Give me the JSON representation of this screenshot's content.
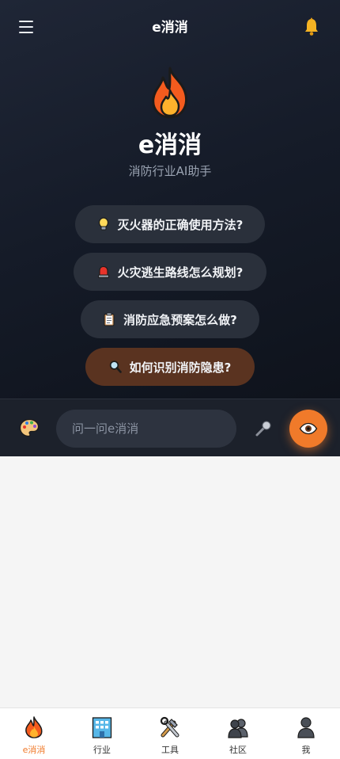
{
  "header": {
    "title": "e消消",
    "menu_icon": "hamburger-menu-icon",
    "bell_icon": "bell-icon"
  },
  "hero": {
    "logo_icon": "fire-icon",
    "app_name": "e消消",
    "subtitle": "消防行业AI助手"
  },
  "suggestions": [
    {
      "icon": "lightbulb-icon",
      "label": "灭火器的正确使用方法?"
    },
    {
      "icon": "siren-icon",
      "label": "火灾逃生路线怎么规划?"
    },
    {
      "icon": "clipboard-icon",
      "label": "消防应急预案怎么做?"
    },
    {
      "icon": "magnifier-icon",
      "label": "如何识别消防隐患?"
    }
  ],
  "input_bar": {
    "palette_icon": "palette-icon",
    "placeholder": "问一问e消消",
    "mic_icon": "microphone-icon",
    "eye_icon": "eye-icon"
  },
  "tabs": [
    {
      "icon": "fire-icon",
      "label": "e消消",
      "active": true
    },
    {
      "icon": "office-building-icon",
      "label": "行业",
      "active": false
    },
    {
      "icon": "tools-icon",
      "label": "工具",
      "active": false
    },
    {
      "icon": "people-icon",
      "label": "社区",
      "active": false
    },
    {
      "icon": "person-icon",
      "label": "我",
      "active": false
    }
  ],
  "colors": {
    "accent": "#f07a2a",
    "hero_bg": "#151b28",
    "chip_bg": "#2a303b",
    "chip_active_bg": "#5a3320"
  }
}
